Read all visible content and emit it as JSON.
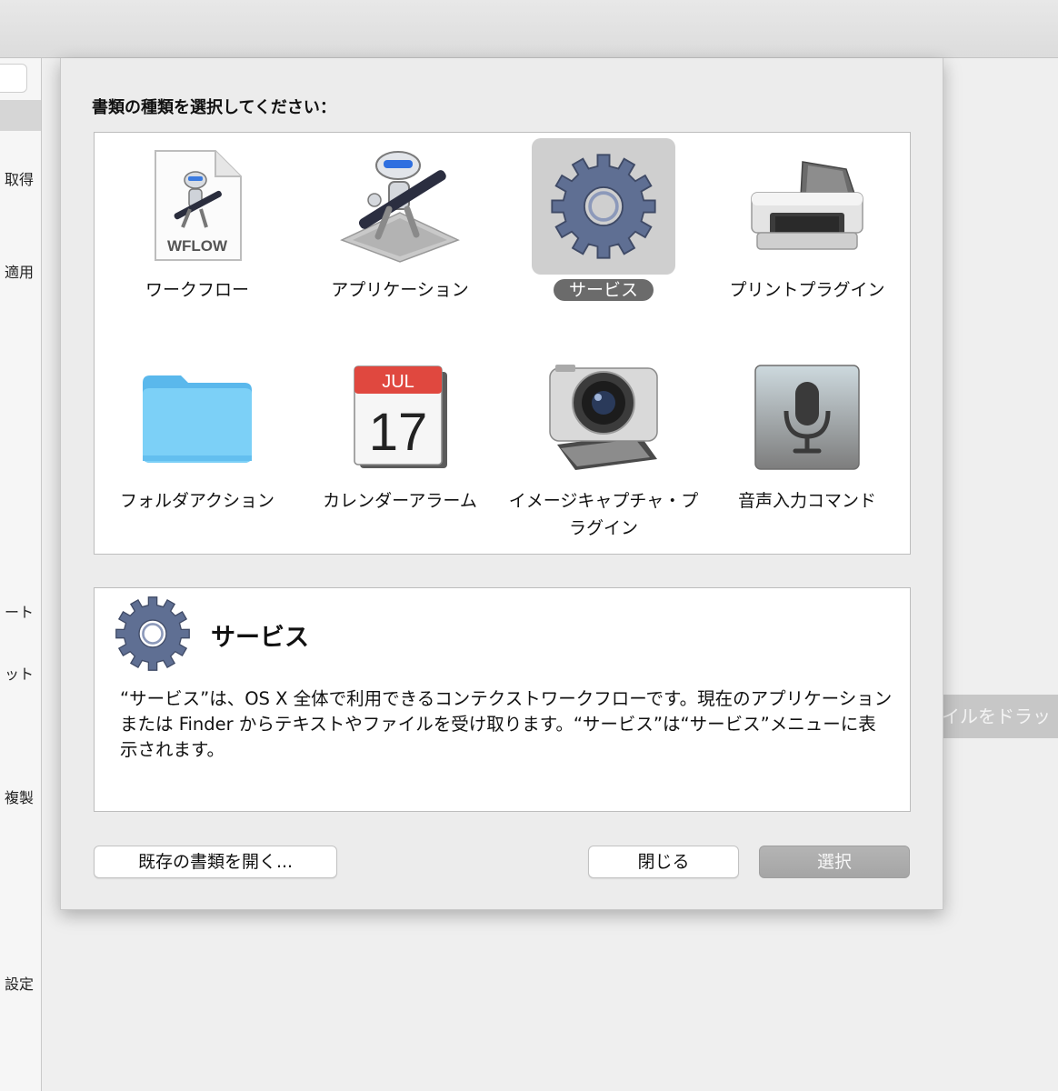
{
  "background": {
    "sidebar_items": [
      "取得",
      "適用",
      "ート",
      "ット",
      "複製",
      "設定"
    ],
    "drop_hint": "イルをドラッ"
  },
  "dialog": {
    "prompt": "書類の種類を選択してください：",
    "types": [
      {
        "label": "ワークフロー",
        "icon": "workflow-icon",
        "selected": false
      },
      {
        "label": "アプリケーション",
        "icon": "automator-robot-icon",
        "selected": false
      },
      {
        "label": "サービス",
        "icon": "gear-icon",
        "selected": true
      },
      {
        "label": "プリントプラグイン",
        "icon": "printer-icon",
        "selected": false
      },
      {
        "label": "フォルダアクション",
        "icon": "folder-icon",
        "selected": false
      },
      {
        "label": "カレンダーアラーム",
        "icon": "calendar-icon",
        "selected": false
      },
      {
        "label": "イメージキャプチャ・プラグイン",
        "icon": "camera-icon",
        "selected": false
      },
      {
        "label": "音声入力コマンド",
        "icon": "microphone-icon",
        "selected": false
      }
    ],
    "workflow_badge": "WFLOW",
    "calendar_month": "JUL",
    "calendar_day": "17",
    "description": {
      "title": "サービス",
      "text": "“サービス”は、OS X 全体で利用できるコンテクストワークフローです。現在のアプリケーションまたは Finder からテキストやファイルを受け取ります。“サービス”は“サービス”メニューに表示されます。"
    },
    "buttons": {
      "open_existing": "既存の書類を開く...",
      "close": "閉じる",
      "choose": "選択"
    }
  },
  "colors": {
    "selection_pill": "#6b6b6b",
    "gear": "#5f6f93",
    "folder": "#6fc5f3",
    "calendar_header": "#e0483f"
  }
}
